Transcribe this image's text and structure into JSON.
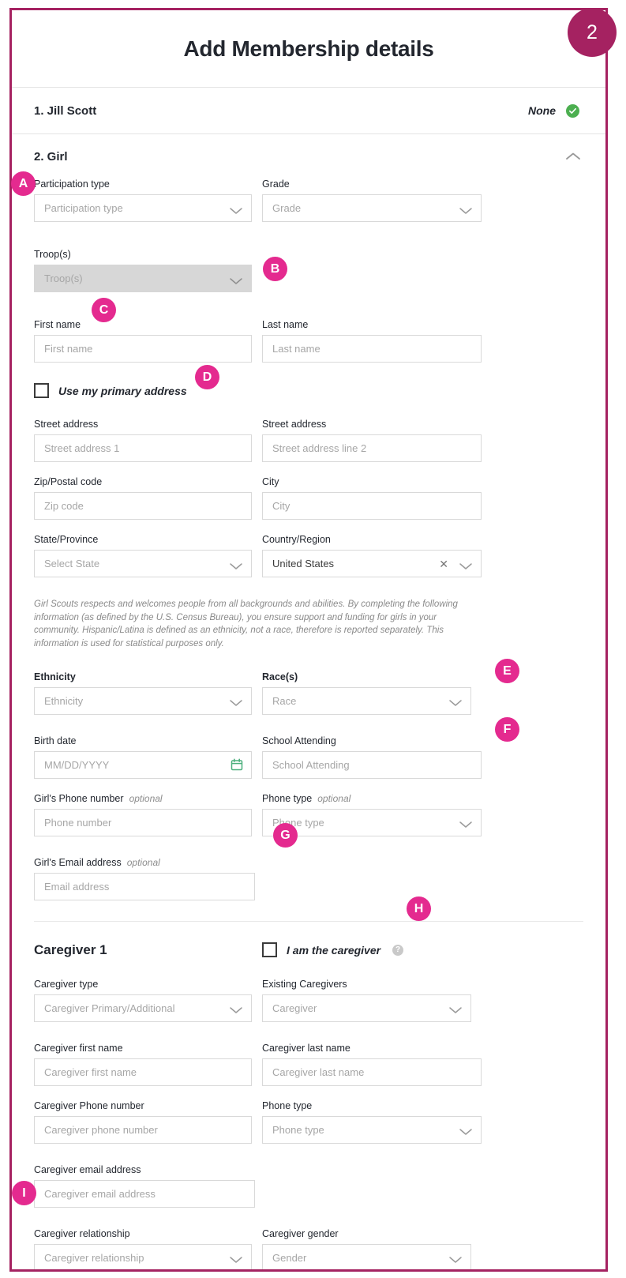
{
  "page": {
    "title": "Add Membership details",
    "step_badge": "2"
  },
  "members": [
    {
      "index_label": "1. Jill Scott",
      "status": "None",
      "status_icon": "check-circle-icon"
    }
  ],
  "section": {
    "title": "2. Girl",
    "collapse_icon": "chevron-up-icon"
  },
  "fields": {
    "participation_type": {
      "label": "Participation type",
      "placeholder": "Participation type"
    },
    "grade": {
      "label": "Grade",
      "placeholder": "Grade"
    },
    "troops": {
      "label": "Troop(s)",
      "placeholder": "Troop(s)"
    },
    "first_name": {
      "label": "First name",
      "placeholder": "First name"
    },
    "last_name": {
      "label": "Last name",
      "placeholder": "Last name"
    },
    "use_primary_address": {
      "label": "Use my primary address"
    },
    "street_address_1": {
      "label": "Street address",
      "placeholder": "Street address 1"
    },
    "street_address_2": {
      "label": "Street address",
      "placeholder": "Street address line 2"
    },
    "zip": {
      "label": "Zip/Postal code",
      "placeholder": "Zip code"
    },
    "city": {
      "label": "City",
      "placeholder": "City"
    },
    "state": {
      "label": "State/Province",
      "placeholder": "Select State"
    },
    "country": {
      "label": "Country/Region",
      "value": "United States",
      "clear_icon": "clear-x-icon"
    },
    "ethnicity": {
      "label": "Ethnicity",
      "placeholder": "Ethnicity"
    },
    "race": {
      "label": "Race(s)",
      "placeholder": "Race"
    },
    "birth_date": {
      "label": "Birth date",
      "placeholder": "MM/DD/YYYY",
      "icon": "calendar-icon"
    },
    "school_attending": {
      "label": "School Attending",
      "placeholder": "School Attending"
    },
    "girl_phone": {
      "label": "Girl's Phone number",
      "optional": "optional",
      "placeholder": "Phone number"
    },
    "girl_phone_type": {
      "label": "Phone type",
      "optional": "optional",
      "placeholder": "Phone type"
    },
    "girl_email": {
      "label": "Girl's Email address",
      "optional": "optional",
      "placeholder": "Email address"
    },
    "caregiver_heading": "Caregiver 1",
    "i_am_caregiver": {
      "label": "I am the caregiver",
      "help_icon": "help-circle-icon"
    },
    "caregiver_type": {
      "label": "Caregiver type",
      "placeholder": "Caregiver Primary/Additional"
    },
    "existing_caregivers": {
      "label": "Existing Caregivers",
      "placeholder": "Caregiver"
    },
    "caregiver_first_name": {
      "label": "Caregiver first name",
      "placeholder": "Caregiver first name"
    },
    "caregiver_last_name": {
      "label": "Caregiver last name",
      "placeholder": "Caregiver last name"
    },
    "caregiver_phone": {
      "label": "Caregiver Phone number",
      "placeholder": "Caregiver phone number"
    },
    "caregiver_phone_type": {
      "label": "Phone type",
      "placeholder": "Phone type"
    },
    "caregiver_email": {
      "label": "Caregiver email address",
      "placeholder": "Caregiver email address"
    },
    "caregiver_relationship": {
      "label": "Caregiver relationship",
      "placeholder": "Caregiver relationship"
    },
    "caregiver_gender": {
      "label": "Caregiver gender",
      "placeholder": "Gender"
    }
  },
  "disclaimer": "Girl Scouts respects and welcomes people from all backgrounds and abilities. By completing the following information (as defined by the U.S. Census Bureau), you ensure support and funding for girls in your community. Hispanic/Latina is defined as an ethnicity, not a race, therefore is reported separately. This information is used for statistical purposes only.",
  "markers": {
    "a": "A",
    "b": "B",
    "c": "C",
    "d": "D",
    "e": "E",
    "f": "F",
    "g": "G",
    "h": "H",
    "i": "I"
  },
  "colors": {
    "marker_pink": "#e42a8f",
    "frame_magenta": "#a52261",
    "status_green": "#4caf50",
    "calendar_green": "#4caf7d"
  }
}
